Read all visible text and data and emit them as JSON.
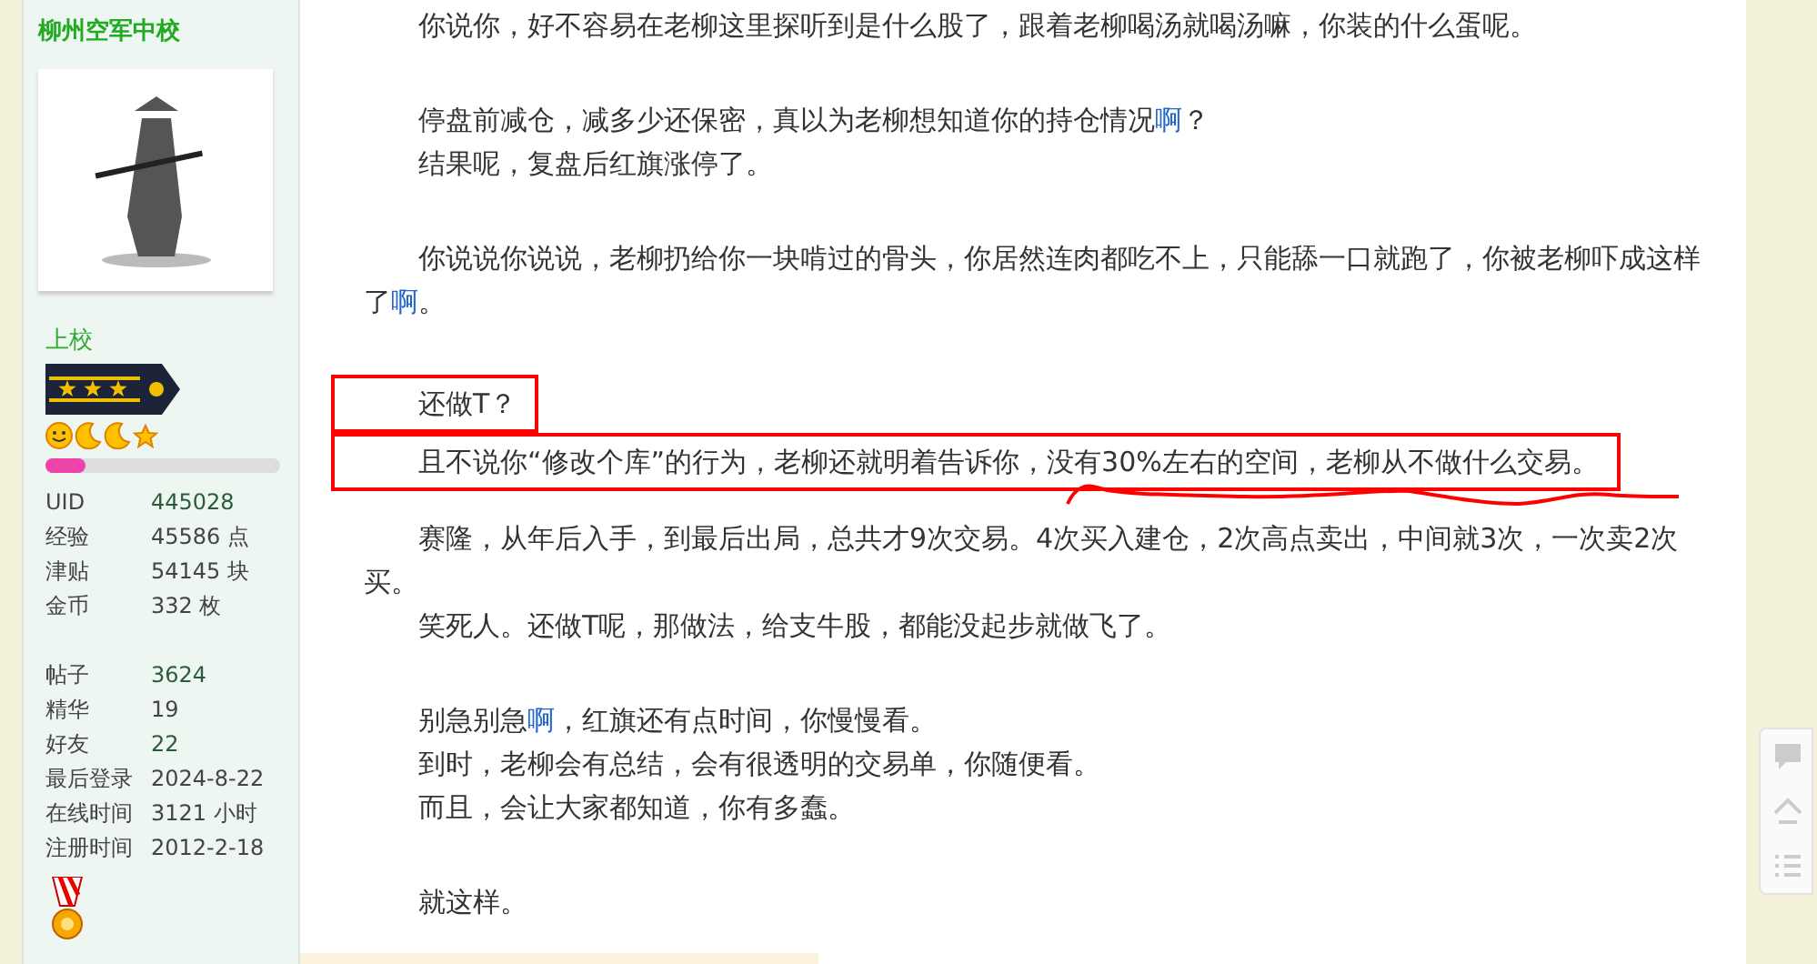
{
  "profile": {
    "username": "柳州空军中校",
    "rank": "上校",
    "level": 0.17,
    "stats": [
      {
        "label": "UID",
        "value": "445028",
        "linked": true
      },
      {
        "label": "经验",
        "value": "45586 点",
        "linked": false
      },
      {
        "label": "津贴",
        "value": "54145 块",
        "linked": false
      },
      {
        "label": "金币",
        "value": "332 枚",
        "linked": false
      }
    ],
    "stats_2": [
      {
        "label": "帖子",
        "value": "3624",
        "linked": true
      },
      {
        "label": "精华",
        "value": "19",
        "linked": false
      },
      {
        "label": "好友",
        "value": "22",
        "linked": true
      },
      {
        "label": "最后登录",
        "value": "2024-8-22",
        "linked": false
      },
      {
        "label": "在线时间",
        "value": "3121 小时",
        "linked": false
      },
      {
        "label": "注册时间",
        "value": "2012-2-18",
        "linked": false
      }
    ]
  },
  "post": {
    "blocks": [
      {
        "lines": [
          {
            "boxed": false,
            "squiggle": false,
            "parts": [
              {
                "kind": "plain",
                "text": "你说你，好不容易在老柳这里探听到是什么股了，跟着老柳喝汤就喝汤嘛，你装的什么蛋呢。"
              }
            ]
          }
        ]
      },
      {
        "lines": [
          {
            "boxed": false,
            "squiggle": false,
            "parts": [
              {
                "kind": "plain",
                "text": "停盘前减仓，减多少还保密，真以为老柳想知道你的持仓情况"
              },
              {
                "kind": "keyword",
                "text": "啊"
              },
              {
                "kind": "plain",
                "text": "？"
              }
            ]
          },
          {
            "boxed": false,
            "squiggle": false,
            "parts": [
              {
                "kind": "plain",
                "text": "结果呢，复盘后红旗涨停了。"
              }
            ]
          }
        ]
      },
      {
        "lines": [
          {
            "boxed": false,
            "squiggle": false,
            "parts": [
              {
                "kind": "plain",
                "text": "你说说你说说，老柳扔给你一块啃过的骨头，你居然连肉都吃不上，只能舔一口就跑了，你被老柳吓成这样了"
              },
              {
                "kind": "keyword",
                "text": "啊"
              },
              {
                "kind": "plain",
                "text": "。"
              }
            ]
          }
        ]
      },
      {
        "lines": [
          {
            "boxed": true,
            "squiggle": false,
            "parts": [
              {
                "kind": "plain",
                "text": "还做T？"
              }
            ]
          },
          {
            "boxed": true,
            "squiggle": true,
            "parts": [
              {
                "kind": "plain",
                "text": "且不说你“修改个库”的行为，老柳还就明着告诉你，没有30%左右的空间，老柳从不做什么交易。"
              }
            ]
          },
          {
            "boxed": false,
            "squiggle": false,
            "parts": [
              {
                "kind": "plain",
                "text": "赛隆，从年后入手，到最后出局，总共才9次交易。4次买入建仓，2次高点卖出，中间就3次，一次卖2次买。"
              }
            ]
          },
          {
            "boxed": false,
            "squiggle": false,
            "parts": [
              {
                "kind": "plain",
                "text": "笑死人。还做T呢，那做法，给支牛股，都能没起步就做飞了。"
              }
            ]
          }
        ]
      },
      {
        "lines": [
          {
            "boxed": false,
            "squiggle": false,
            "parts": [
              {
                "kind": "plain",
                "text": "别急别急"
              },
              {
                "kind": "keyword",
                "text": "啊"
              },
              {
                "kind": "plain",
                "text": "，红旗还有点时间，你慢慢看。"
              }
            ]
          },
          {
            "boxed": false,
            "squiggle": false,
            "parts": [
              {
                "kind": "plain",
                "text": "到时，老柳会有总结，会有很透明的交易单，你随便看。"
              }
            ]
          },
          {
            "boxed": false,
            "squiggle": false,
            "parts": [
              {
                "kind": "plain",
                "text": "而且，会让大家都知道，你有多蠢。"
              }
            ]
          }
        ]
      },
      {
        "lines": [
          {
            "boxed": false,
            "squiggle": false,
            "parts": [
              {
                "kind": "plain",
                "text": "就这样。"
              }
            ]
          }
        ]
      }
    ]
  }
}
